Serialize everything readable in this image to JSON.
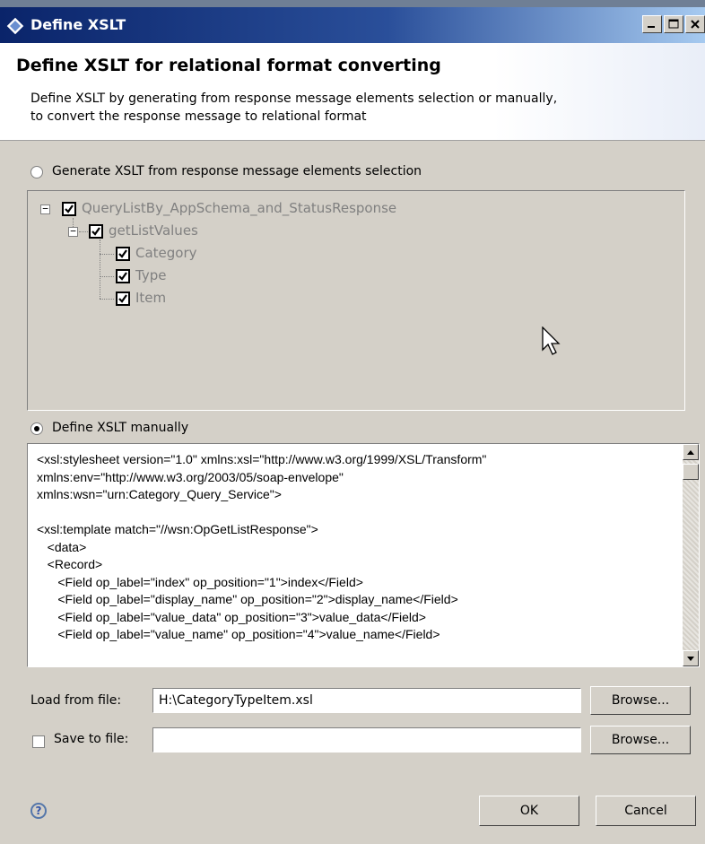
{
  "window": {
    "title": "Define XSLT",
    "controls": [
      "minimize-icon",
      "maximize-icon",
      "close-icon"
    ]
  },
  "header": {
    "title": "Define XSLT for relational format converting",
    "description": "Define XSLT by generating from response message elements selection or manually,\n to convert the response message to relational format"
  },
  "options": {
    "generate_label": "Generate XSLT from response message elements selection",
    "generate_selected": false,
    "manual_label": "Define XSLT manually",
    "manual_selected": true
  },
  "tree": {
    "root": {
      "label": "QueryListBy_AppSchema_and_StatusResponse",
      "checked": true,
      "expanded": true
    },
    "child": {
      "label": "getListValues",
      "checked": true,
      "expanded": true
    },
    "leaves": [
      {
        "label": "Category",
        "checked": true
      },
      {
        "label": "Type",
        "checked": true
      },
      {
        "label": "Item",
        "checked": true
      }
    ]
  },
  "xslt": {
    "lines": [
      "<xsl:stylesheet version=\"1.0\" xmlns:xsl=\"http://www.w3.org/1999/XSL/Transform\"",
      "xmlns:env=\"http://www.w3.org/2003/05/soap-envelope\"",
      "xmlns:wsn=\"urn:Category_Query_Service\">",
      "",
      "<xsl:template match=\"//wsn:OpGetListResponse\">",
      "   <data>",
      "   <Record>",
      "      <Field op_label=\"index\" op_position=\"1\">index</Field>",
      "      <Field op_label=\"display_name\" op_position=\"2\">display_name</Field>",
      "      <Field op_label=\"value_data\" op_position=\"3\">value_data</Field>",
      "      <Field op_label=\"value_name\" op_position=\"4\">value_name</Field>"
    ]
  },
  "load": {
    "label": "Load from file:",
    "value": "H:\\CategoryTypeItem.xsl",
    "browse_label": "Browse..."
  },
  "save": {
    "label": "Save to file:",
    "checked": false,
    "value": "",
    "browse_label": "Browse..."
  },
  "footer": {
    "help_icon": "help-icon",
    "ok_label": "OK",
    "cancel_label": "Cancel"
  }
}
